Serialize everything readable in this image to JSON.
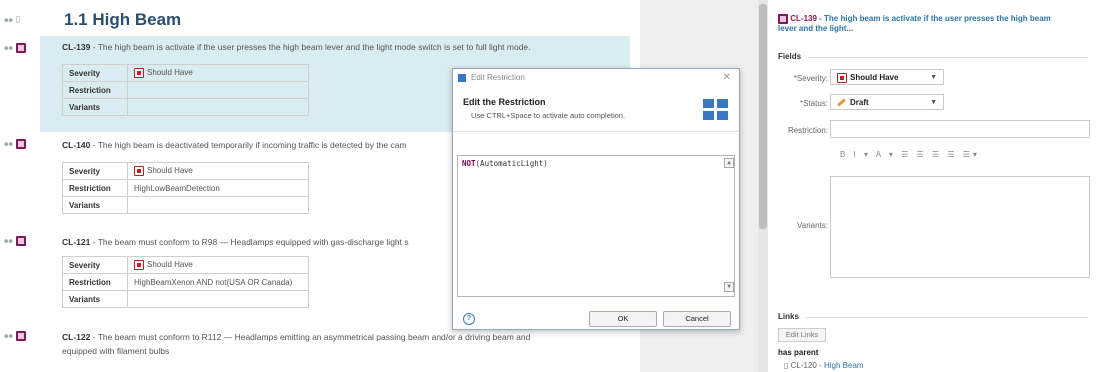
{
  "doc": {
    "title": "1.1 High Beam",
    "requirements": [
      {
        "id": "CL-139",
        "text": " - The high beam is activate if the user presses the high beam lever and the light mode switch is set to full light mode.",
        "fields": {
          "severity_key": "Severity",
          "severity_val": "Should Have",
          "restriction_key": "Restriction",
          "restriction_val": "",
          "variants_key": "Variants",
          "variants_val": ""
        }
      },
      {
        "id": "CL-140",
        "text": " - The high beam is deactivated temporarily if incoming traffic is detected by the cam",
        "fields": {
          "severity_key": "Severity",
          "severity_val": "Should Have",
          "restriction_key": "Restriction",
          "restriction_val": "HighLowBeamDetection",
          "variants_key": "Variants",
          "variants_val": ""
        }
      },
      {
        "id": "CL-121",
        "text": " - The beam must conform to R98 — Headlamps equipped with gas-discharge light s",
        "fields": {
          "severity_key": "Severity",
          "severity_val": "Should Have",
          "restriction_key": "Restriction",
          "restriction_val": "HighBeamXenon AND not(USA OR Canada)",
          "variants_key": "Variants",
          "variants_val": ""
        }
      },
      {
        "id": "CL-122",
        "text": " - The beam must conform to R112 — Headlamps emitting an asymmetrical passing beam and/or a driving beam and",
        "text2": "equipped with filament bulbs"
      }
    ]
  },
  "dialog": {
    "window_title": "Edit Restriction",
    "heading": "Edit the Restriction",
    "description": "Use CTRL+Space to activate auto completion.",
    "code_keyword": "NOT",
    "code_rest": "(AutomaticLight)",
    "ok_label": "OK",
    "cancel_label": "Cancel",
    "help_label": "?"
  },
  "side": {
    "req_id": "CL-139",
    "req_title_1": " - The high beam is activate if the user presses the high beam",
    "req_title_2": "lever and the light...",
    "fields_label": "Fields",
    "severity_label": "*Severity:",
    "severity_value": "Should Have",
    "status_label": "*Status:",
    "status_value": "Draft",
    "restriction_label": "Restriction:",
    "variants_label": "Variants:",
    "toolbar": "B I ▾ A ▾ ☰ ☰ ☰ ☰ ☰▾",
    "links_label": "Links",
    "edit_links": "Edit Links",
    "has_parent": "has parent",
    "parent_id": "CL-120",
    "parent_sep": " - ",
    "parent_title": "High Beam"
  },
  "colors": {
    "selected_row": "#d9ecf2",
    "title": "#2d4e6e",
    "link": "#2e73a8",
    "req_icon": "#7b1b5d"
  }
}
